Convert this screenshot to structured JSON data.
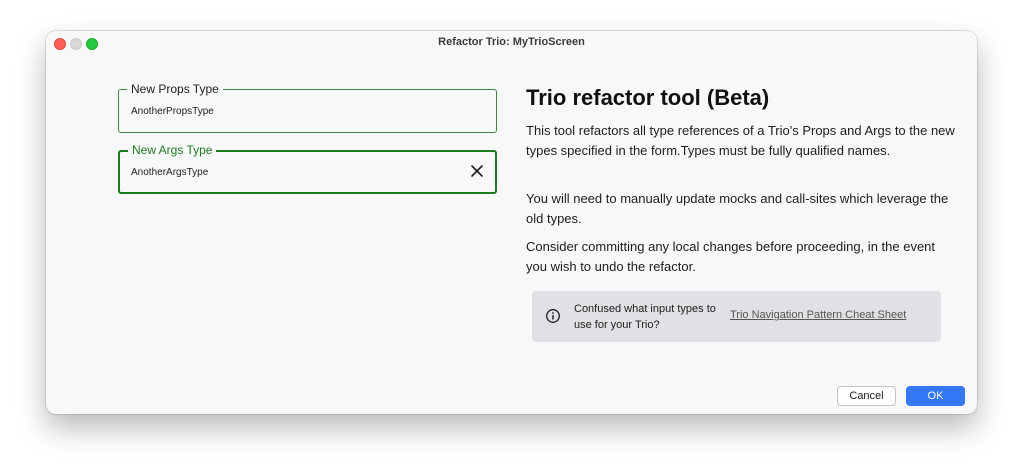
{
  "window": {
    "title": "Refactor Trio: MyTrioScreen"
  },
  "form": {
    "props_field": {
      "label": "New Props Type",
      "value": "AnotherPropsType"
    },
    "args_field": {
      "label": "New Args Type",
      "value": "AnotherArgsType",
      "clear_icon": "close-icon"
    }
  },
  "help": {
    "title": "Trio refactor tool (Beta)",
    "paragraph1": "This tool refactors all type references of a Trio's Props and Args to the new types specified in the form.Types must be fully qualified names.",
    "paragraph2": "You will need to manually update mocks and call-sites which leverage the old types.",
    "paragraph3": "Consider committing any local changes before proceeding, in the event you wish to undo the refactor.",
    "info_box": {
      "icon": "info-icon",
      "question": "Confused what input types to use for your Trio?",
      "link": "Trio Navigation Pattern Cheat Sheet"
    }
  },
  "footer": {
    "cancel_label": "Cancel",
    "ok_label": "OK"
  },
  "colors": {
    "focus_green": "#1f7a22",
    "primary_blue": "#3478f6",
    "close_red": "#ff5f57",
    "maximize_green": "#28c840"
  }
}
